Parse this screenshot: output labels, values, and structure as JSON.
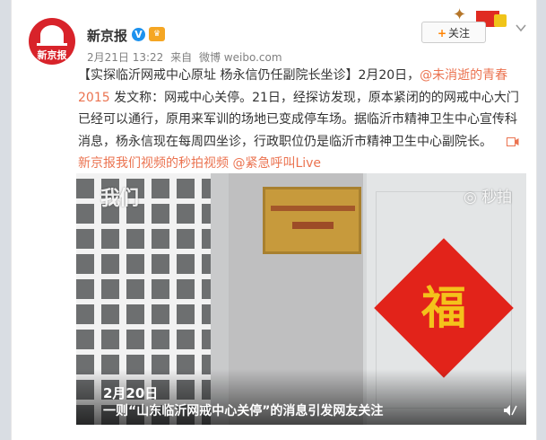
{
  "post": {
    "author": "新京报",
    "verified_mark": "V",
    "meta": {
      "date": "2月21日 13:22",
      "source_prefix": "来自",
      "source": "微博 weibo.com"
    },
    "follow_label": "关注",
    "text": {
      "headline": "【实探临沂网戒中心原址 杨永信仍任副院长坐诊】2月20日，",
      "mention1": "@未消逝的青春2015",
      "body": " 发文称：网戒中心关停。21日，经探访发现，原本紧闭的的网戒中心大门已经可以通行，原用来军训的场地已变成停车场。据临沂市精神卫生中心宣传科消息，杨永信现在每周四坐诊，行政职位仍是临沂市精神卫生中心副院长。",
      "video_link": "新京报我们视频的秒拍视频",
      "mention2": "@紧急呼叫Live"
    }
  },
  "video": {
    "watermark_left": "我们",
    "watermark_right": "秒拍",
    "fu_char": "福",
    "caption_date": "2月20日",
    "caption_text": "一则“山东临沂网戒中心关停”的消息引发网友关注"
  },
  "avatar": {
    "logo_text": "新京报"
  },
  "colors": {
    "link": "#eb7350",
    "brand_red": "#d8232a",
    "verified_blue": "#1d92ee"
  }
}
